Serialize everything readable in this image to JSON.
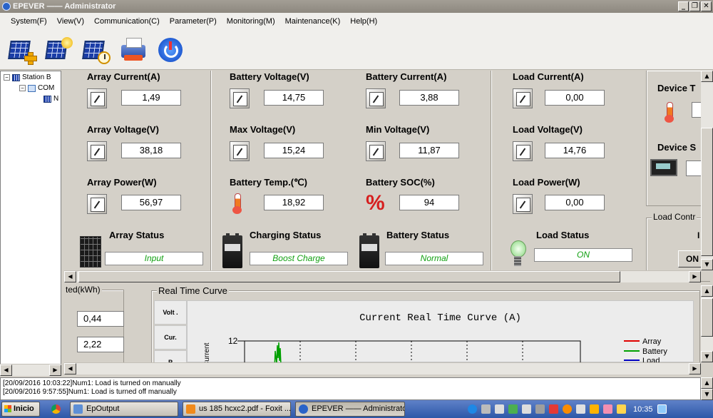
{
  "window": {
    "title": "EPEVER —— Administrator"
  },
  "menu": [
    "System(F)",
    "View(V)",
    "Communication(C)",
    "Parameter(P)",
    "Monitoring(M)",
    "Maintenance(K)",
    "Help(H)"
  ],
  "tree": {
    "root": "Station B",
    "child": "COM",
    "leaf": "N"
  },
  "metrics": {
    "array_current": {
      "label": "Array Current(A)",
      "value": "1,49"
    },
    "array_voltage": {
      "label": "Array Voltage(V)",
      "value": "38,18"
    },
    "array_power": {
      "label": "Array Power(W)",
      "value": "56,97"
    },
    "battery_voltage": {
      "label": "Battery Voltage(V)",
      "value": "14,75"
    },
    "max_voltage": {
      "label": "Max Voltage(V)",
      "value": "15,24"
    },
    "battery_temp": {
      "label": "Battery Temp.(℃)",
      "value": "18,92"
    },
    "battery_current": {
      "label": "Battery Current(A)",
      "value": "3,88"
    },
    "min_voltage": {
      "label": "Min Voltage(V)",
      "value": "11,87"
    },
    "battery_soc": {
      "label": "Battery SOC(%)",
      "value": "94"
    },
    "load_current": {
      "label": "Load Current(A)",
      "value": "0,00"
    },
    "load_voltage": {
      "label": "Load Voltage(V)",
      "value": "14,76"
    },
    "load_power": {
      "label": "Load Power(W)",
      "value": "0,00"
    }
  },
  "status": {
    "array": {
      "title": "Array Status",
      "value": "Input"
    },
    "charging": {
      "title": "Charging Status",
      "value": "Boost Charge"
    },
    "battery": {
      "title": "Battery Status",
      "value": "Normal"
    },
    "load": {
      "title": "Load Status",
      "value": "ON"
    }
  },
  "right": {
    "device_t": "Device T",
    "device_s": "Device S",
    "load_ctrl": "Load Contr",
    "load_ctrl_mark": "I",
    "on_button": "ON"
  },
  "energy": {
    "label": "ted(kWh)",
    "values": [
      "0,44",
      "2,22"
    ]
  },
  "curve": {
    "group_label": "Real Time Curve",
    "tabs": [
      "Volt .",
      "Cur.",
      "P"
    ],
    "title": "Current Real Time Curve (A)",
    "y_label": "Current",
    "y_tick": "12",
    "legend": [
      {
        "name": "Array",
        "color": "#e00000"
      },
      {
        "name": "Battery",
        "color": "#00a000"
      },
      {
        "name": "Load",
        "color": "#0000c0"
      }
    ]
  },
  "log": [
    "[20/09/2016 10:03:22]Num1: Load is turned on manually",
    "[20/09/2016 9:57:55]Num1: Load is turned off manually"
  ],
  "taskbar": {
    "start": "Inicio",
    "tasks": [
      "EpOutput",
      "us 185 hcxc2.pdf - Foxit ...",
      "EPEVER —— Administrator"
    ],
    "time": "10:35"
  },
  "colors": {
    "status_text": "#13a113",
    "taskbar": "#2d58a8"
  }
}
